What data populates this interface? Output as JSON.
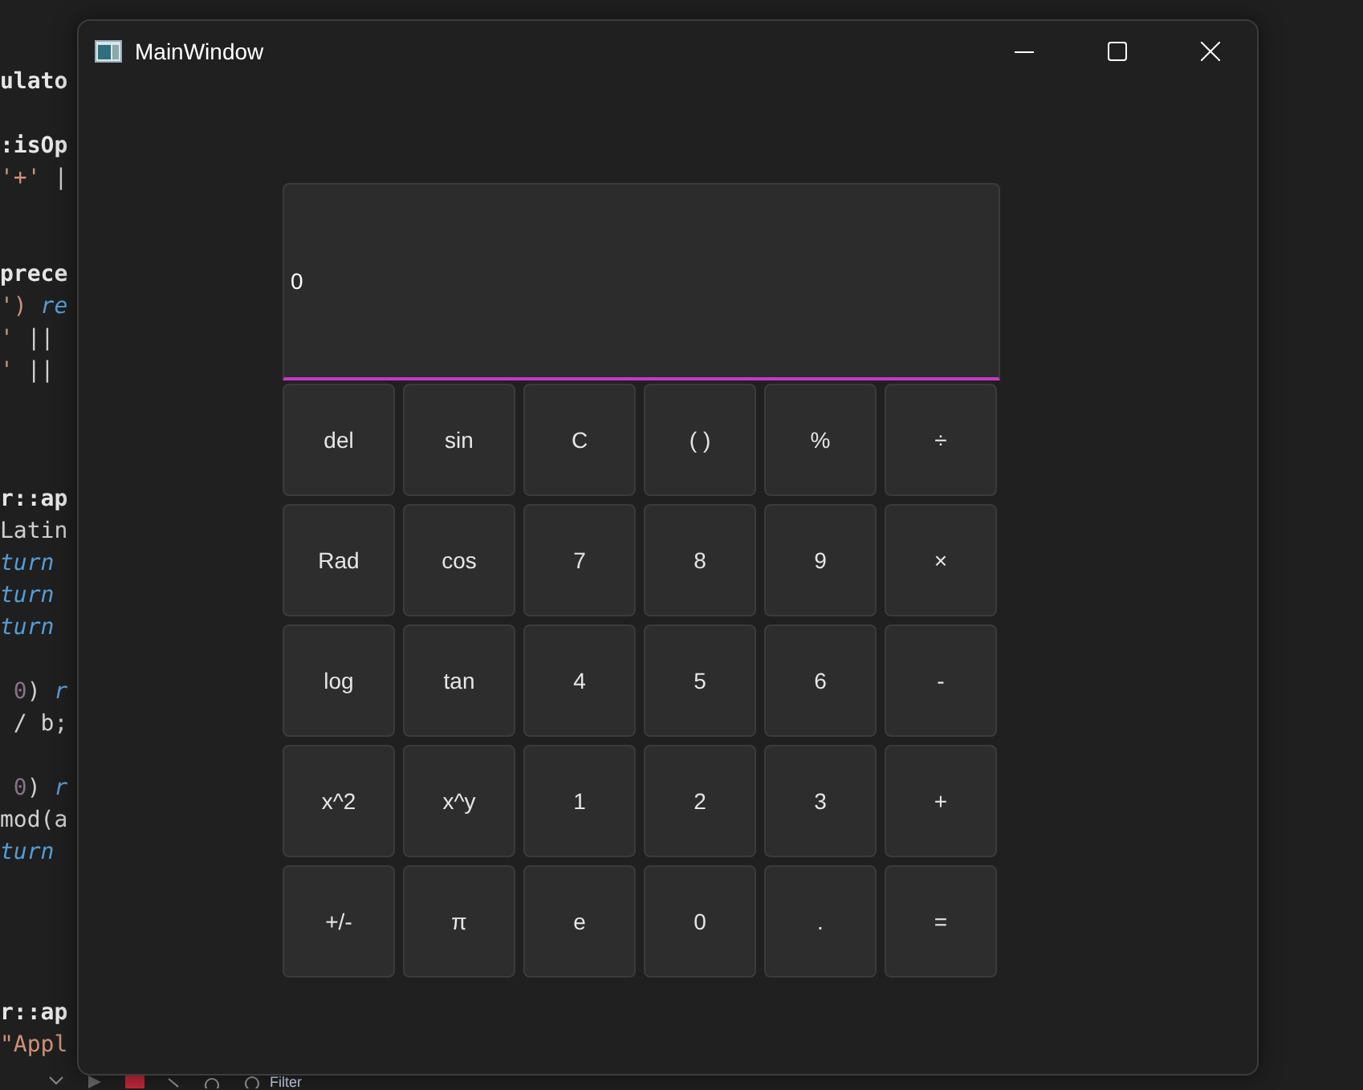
{
  "editor": {
    "lines": [
      [
        {
          "text": "ulato",
          "kind": "bold"
        }
      ],
      [
        {
          "text": ":isOp",
          "kind": "bold"
        }
      ],
      [
        {
          "text": "'+'",
          "kind": "string"
        },
        {
          "text": " |",
          "kind": "plain"
        }
      ],
      [
        {
          "text": "prece",
          "kind": "bold"
        }
      ],
      [
        {
          "text": "')",
          "kind": "string"
        },
        {
          "text": " re",
          "kind": "keyword"
        }
      ],
      [
        {
          "text": "'",
          "kind": "string"
        },
        {
          "text": " ||",
          "kind": "plain"
        }
      ],
      [
        {
          "text": "'",
          "kind": "string"
        },
        {
          "text": " ||",
          "kind": "plain"
        }
      ],
      [
        {
          "text": "r::ap",
          "kind": "bold"
        }
      ],
      [
        {
          "text": "Latin",
          "kind": "plain"
        }
      ],
      [
        {
          "text": "turn",
          "kind": "keyword"
        }
      ],
      [
        {
          "text": "turn",
          "kind": "keyword"
        }
      ],
      [
        {
          "text": "turn",
          "kind": "keyword"
        }
      ],
      [
        {
          "text": " 0",
          "kind": "number"
        },
        {
          "text": ") ",
          "kind": "plain"
        },
        {
          "text": "r",
          "kind": "keyword"
        }
      ],
      [
        {
          "text": " / b;",
          "kind": "plain"
        }
      ],
      [
        {
          "text": " 0",
          "kind": "number"
        },
        {
          "text": ") ",
          "kind": "plain"
        },
        {
          "text": "r",
          "kind": "keyword"
        }
      ],
      [
        {
          "text": "mod(a",
          "kind": "plain"
        }
      ],
      [
        {
          "text": "turn",
          "kind": "keyword"
        }
      ],
      [
        {
          "text": "r::ap",
          "kind": "bold"
        }
      ],
      [
        {
          "text": "\"Appl",
          "kind": "string"
        }
      ]
    ]
  },
  "toolbar": {
    "filter": "Filter"
  },
  "window": {
    "title": "MainWindow"
  },
  "display": {
    "value": "0",
    "focused": true
  },
  "buttons": [
    "del",
    "sin",
    "C",
    "( )",
    "%",
    "÷",
    "Rad",
    "cos",
    "7",
    "8",
    "9",
    "×",
    "log",
    "tan",
    "4",
    "5",
    "6",
    "-",
    "x^2",
    "x^y",
    "1",
    "2",
    "3",
    "+",
    "+/-",
    "π",
    "e",
    "0",
    ".",
    "="
  ]
}
